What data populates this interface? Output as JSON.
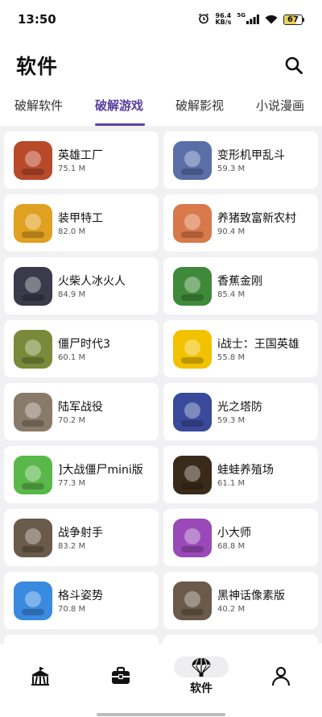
{
  "status_bar": {
    "time": "13:50",
    "net_speed_value": "96.4",
    "net_speed_unit": "KB/s",
    "network_type": "5G",
    "battery": "67",
    "battery_level": 0.67,
    "battery_color": "#e8d25a",
    "icons": [
      "alarm-icon",
      "signal-icon",
      "wifi-icon",
      "battery-icon"
    ]
  },
  "header": {
    "title": "软件",
    "search_icon": "search-icon"
  },
  "tabs": [
    {
      "label": "破解软件",
      "active": false
    },
    {
      "label": "破解游戏",
      "active": true
    },
    {
      "label": "破解影视",
      "active": false
    },
    {
      "label": "小说漫画",
      "active": false
    }
  ],
  "accent_color": "#5a3fa0",
  "apps": [
    {
      "name": "英雄工厂",
      "size": "75.1 M",
      "icon": "hero-factory-icon",
      "color": "#b84a2a"
    },
    {
      "name": "变形机甲乱斗",
      "size": "59.3 M",
      "icon": "mecha-battle-icon",
      "color": "#5a6fa8"
    },
    {
      "name": "装甲特工",
      "size": "82.0 M",
      "icon": "armored-agent-icon",
      "color": "#e0a020"
    },
    {
      "name": "养猪致富新农村",
      "size": "90.4 M",
      "icon": "pig-farm-icon",
      "color": "#d9784a"
    },
    {
      "name": "火柴人冰火人",
      "size": "84.9 M",
      "icon": "stickman-fire-ice-icon",
      "color": "#3a3a4a"
    },
    {
      "name": "香蕉金刚",
      "size": "85.4 M",
      "icon": "banana-kong-icon",
      "color": "#3f8a3a"
    },
    {
      "name": "僵尸时代3",
      "size": "60.1 M",
      "icon": "zombie-age-icon",
      "color": "#7a8a3a"
    },
    {
      "name": "i战士：王国英雄",
      "size": "55.8 M",
      "icon": "kingdom-hero-icon",
      "color": "#f2c200"
    },
    {
      "name": "陆军战役",
      "size": "70.2 M",
      "icon": "army-campaign-icon",
      "color": "#8a7a6a"
    },
    {
      "name": "光之塔防",
      "size": "59.3 M",
      "icon": "light-tower-icon",
      "color": "#3a4a9a"
    },
    {
      "name": "]大战僵尸mini版",
      "size": "77.3 M",
      "icon": "plants-zombies-icon",
      "color": "#5ab84a"
    },
    {
      "name": "蛙蛙养殖场",
      "size": "61.1 M",
      "icon": "frog-farm-icon",
      "color": "#3a2a1a"
    },
    {
      "name": "战争射手",
      "size": "83.2 M",
      "icon": "war-shooter-icon",
      "color": "#6a5a4a"
    },
    {
      "name": "小大师",
      "size": "68.8 M",
      "icon": "little-master-icon",
      "color": "#9a4ab8"
    },
    {
      "name": "格斗姿势",
      "size": "70.8 M",
      "icon": "fight-pose-icon",
      "color": "#3a8ae0"
    },
    {
      "name": "黑神话像素版",
      "size": "40.2 M",
      "icon": "black-myth-pixel-icon",
      "color": "#6a5a4a"
    },
    {
      "name": "",
      "size": "",
      "icon": "",
      "color": "#ffffff"
    },
    {
      "name": "",
      "size": "",
      "icon": "",
      "color": "#ffffff"
    }
  ],
  "bottom_nav": [
    {
      "icon": "circus-tent-icon",
      "label": "",
      "active": false
    },
    {
      "icon": "toolbox-icon",
      "label": "",
      "active": false
    },
    {
      "icon": "parachute-icon",
      "label": "软件",
      "active": true
    },
    {
      "icon": "person-icon",
      "label": "",
      "active": false
    }
  ]
}
